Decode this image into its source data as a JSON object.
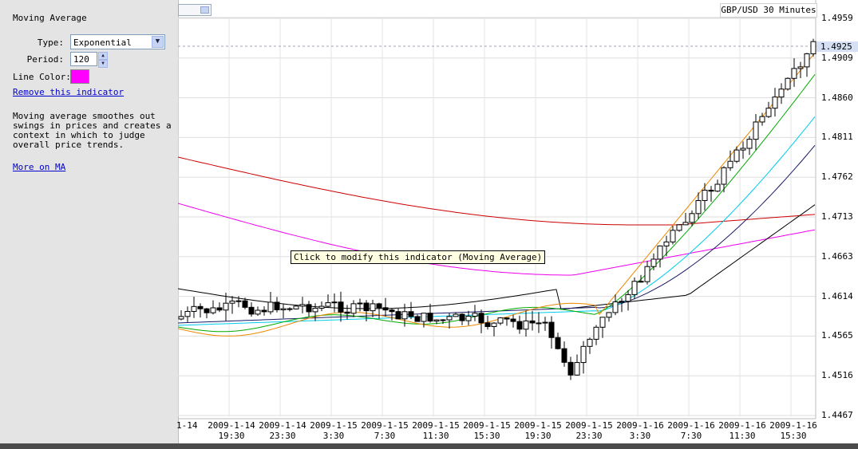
{
  "panel": {
    "title": "Moving Average",
    "type_label": "Type:",
    "type_value": "Exponential",
    "period_label": "Period:",
    "period_value": "120",
    "line_color_label": "Line Color:",
    "line_color": "#ff00ff",
    "remove_link": "Remove this indicator",
    "description": "Moving average smoothes out\nswings in prices and creates a\ncontext in which to judge\noverall price trends.",
    "more_link": "More on MA"
  },
  "chart": {
    "symbol": "GBP/USD",
    "interval": "30 Minutes",
    "tooltip": "Click to modify this indicator (Moving Average)",
    "current_price": "1.4925",
    "price_labels": [
      "1.4959",
      "1.4909",
      "1.4860",
      "1.4811",
      "1.4762",
      "1.4713",
      "1.4663",
      "1.4614",
      "1.4565",
      "1.4516",
      "1.4467"
    ],
    "time_labels": [
      {
        "d": "1-14",
        "t": ""
      },
      {
        "d": "2009-1-14",
        "t": "19:30"
      },
      {
        "d": "2009-1-14",
        "t": "23:30"
      },
      {
        "d": "2009-1-15",
        "t": "3:30"
      },
      {
        "d": "2009-1-15",
        "t": "7:30"
      },
      {
        "d": "2009-1-15",
        "t": "11:30"
      },
      {
        "d": "2009-1-15",
        "t": "15:30"
      },
      {
        "d": "2009-1-15",
        "t": "19:30"
      },
      {
        "d": "2009-1-15",
        "t": "23:30"
      },
      {
        "d": "2009-1-16",
        "t": "3:30"
      },
      {
        "d": "2009-1-16",
        "t": "7:30"
      },
      {
        "d": "2009-1-16",
        "t": "11:30"
      },
      {
        "d": "2009-1-16",
        "t": "15:30"
      }
    ],
    "colors": {
      "ma_red": "#cc0000",
      "ma_magenta": "#ee00ee",
      "ma_black": "#000000",
      "ma_navy": "#1a1a66",
      "ma_cyan": "#00ccee",
      "ma_green": "#00aa00",
      "ma_orange": "#ee8800",
      "ma_blue": "#2244dd"
    }
  }
}
